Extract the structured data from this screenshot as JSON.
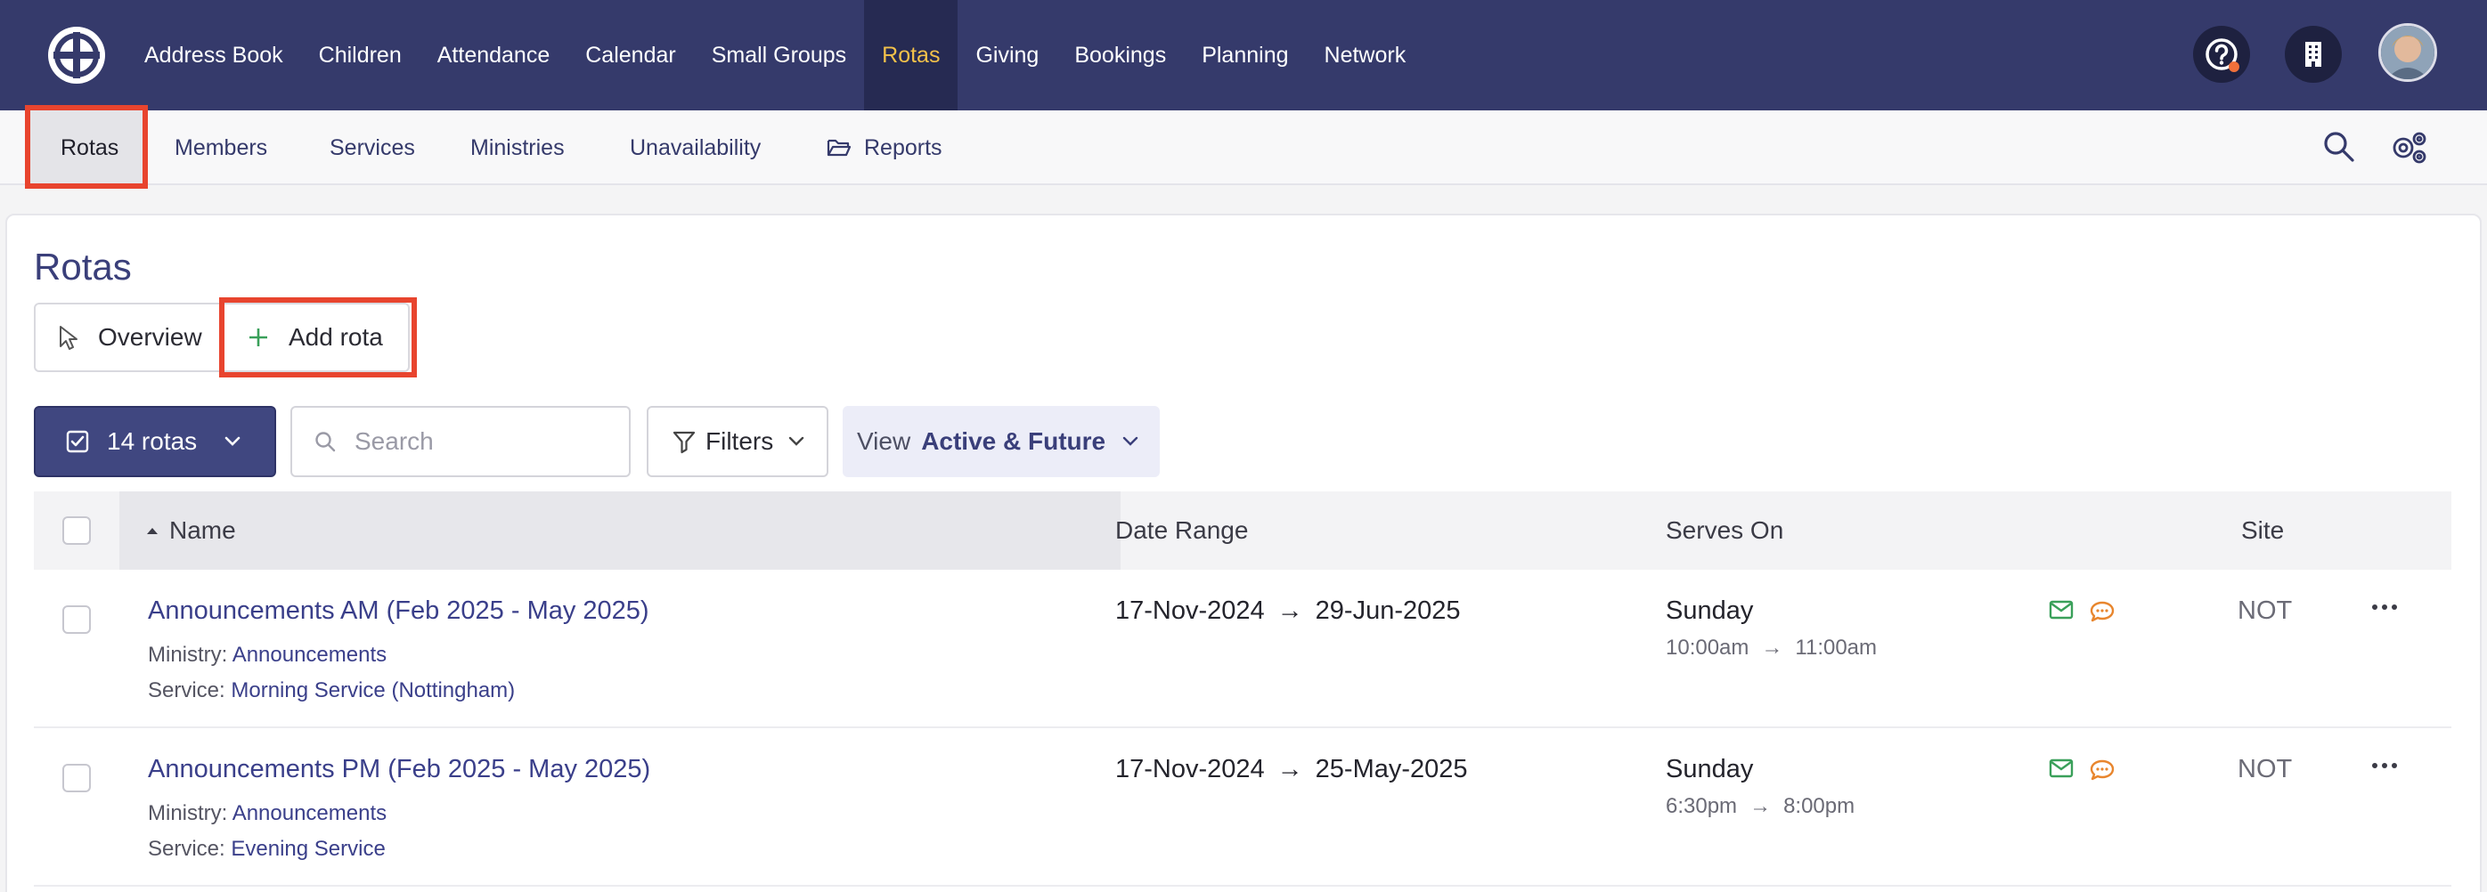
{
  "topnav": {
    "items": [
      {
        "label": "Address Book"
      },
      {
        "label": "Children"
      },
      {
        "label": "Attendance"
      },
      {
        "label": "Calendar"
      },
      {
        "label": "Small Groups"
      },
      {
        "label": "Rotas",
        "active": true
      },
      {
        "label": "Giving"
      },
      {
        "label": "Bookings"
      },
      {
        "label": "Planning"
      },
      {
        "label": "Network"
      }
    ],
    "colors": {
      "bg": "#353a6b",
      "active_bg": "#262a52",
      "active_text": "#f2c14a",
      "badge": "#f0703a"
    }
  },
  "subnav": {
    "items": [
      {
        "label": "Rotas",
        "active": true
      },
      {
        "label": "Members"
      },
      {
        "label": "Services"
      },
      {
        "label": "Ministries"
      },
      {
        "label": "Unavailability"
      },
      {
        "label": "Reports",
        "icon": "folder-open-icon"
      }
    ],
    "icons": [
      "search-icon",
      "settings-gear-icon"
    ]
  },
  "page": {
    "title": "Rotas",
    "actions": {
      "overview": "Overview",
      "add_rota": "Add rota"
    }
  },
  "toolbar": {
    "count_label": "14 rotas",
    "search_placeholder": "Search",
    "filters_label": "Filters",
    "view_prefix": "View",
    "view_value": "Active & Future"
  },
  "table": {
    "headers": {
      "name": "Name",
      "date_range": "Date Range",
      "serves_on": "Serves On",
      "site": "Site"
    },
    "sort": "name-ascending",
    "ministry_prefix": "Ministry:",
    "service_prefix": "Service:",
    "arrow": "→",
    "rows": [
      {
        "name": "Announcements AM (Feb 2025 - May 2025)",
        "ministry": "Announcements",
        "service": "Morning Service (Nottingham)",
        "date_start": "17-Nov-2024",
        "date_end": "29-Jun-2025",
        "day": "Sunday",
        "time_start": "10:00am",
        "time_end": "11:00am",
        "site": "NOT"
      },
      {
        "name": "Announcements PM (Feb 2025 - May 2025)",
        "ministry": "Announcements",
        "service": "Evening Service",
        "date_start": "17-Nov-2024",
        "date_end": "25-May-2025",
        "day": "Sunday",
        "time_start": "6:30pm",
        "time_end": "8:00pm",
        "site": "NOT"
      }
    ]
  },
  "colors": {
    "accent": "#3a3f7a",
    "highlight_border": "#e8442e",
    "mail_icon": "#3aa05a",
    "chat_icon": "#e8862e"
  }
}
